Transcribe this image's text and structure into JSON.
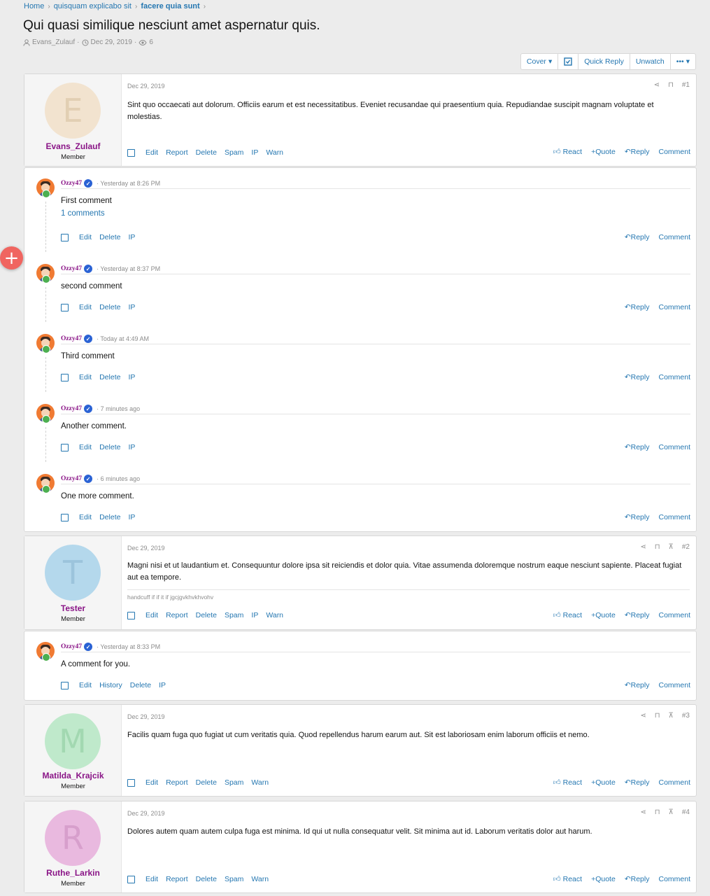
{
  "breadcrumb": {
    "home": "Home",
    "cat": "quisquam explicabo sit",
    "forum": "facere quia sunt"
  },
  "thread": {
    "title": "Qui quasi similique nesciunt amet aspernatur quis.",
    "author": "Evans_Zulauf",
    "date": "Dec 29, 2019",
    "views": "6"
  },
  "toolbar": {
    "cover": "Cover",
    "quick_reply": "Quick Reply",
    "unwatch": "Unwatch",
    "more": "•••"
  },
  "actions": {
    "edit": "Edit",
    "report": "Report",
    "delete": "Delete",
    "spam": "Spam",
    "ip": "IP",
    "warn": "Warn",
    "history": "History",
    "react": "React",
    "quote": "+Quote",
    "reply": "Reply",
    "comment": "Comment"
  },
  "posts": [
    {
      "initial": "E",
      "user": "Evans_Zulauf",
      "title": "Member",
      "date": "Dec 29, 2019",
      "num": "#1",
      "body": "Sint quo occaecati aut dolorum. Officiis earum et est necessitatibus. Eveniet recusandae qui praesentium quia. Repudiandae suscipit magnam voluptate et molestias.",
      "avatar_bg": "#f2e3cf",
      "avatar_fg": "#e2cfb3"
    },
    {
      "initial": "T",
      "user": "Tester",
      "title": "Member",
      "date": "Dec 29, 2019",
      "num": "#2",
      "body": "Magni nisi et ut laudantium et. Consequuntur dolore ipsa sit reiciendis et dolor quia. Vitae assumenda doloremque nostrum eaque nesciunt sapiente. Placeat fugiat aut ea tempore.",
      "signature": "handcuff if if it if jgcjgvkhvkhvohv",
      "avatar_bg": "#b4d8ec",
      "avatar_fg": "#9cc4dc"
    },
    {
      "initial": "M",
      "user": "Matilda_Krajcik",
      "title": "Member",
      "date": "Dec 29, 2019",
      "num": "#3",
      "body": "Facilis quam fuga quo fugiat ut cum veritatis quia. Quod repellendus harum earum aut. Sit est laboriosam enim laborum officiis et nemo.",
      "avatar_bg": "#bfe9cb",
      "avatar_fg": "#a2d8b1"
    },
    {
      "initial": "R",
      "user": "Ruthe_Larkin",
      "title": "Member",
      "date": "Dec 29, 2019",
      "num": "#4",
      "body": "Dolores autem quam autem culpa fuga est minima. Id qui ut nulla consequatur velit. Sit minima aut id. Laborum veritatis dolor aut harum.",
      "avatar_bg": "#e9b9df",
      "avatar_fg": "#d79fcc"
    }
  ],
  "comments": [
    {
      "user": "Ozzy47",
      "time": "Yesterday at 8:26 PM",
      "text": "First comment",
      "sub": "1 comments"
    },
    {
      "user": "Ozzy47",
      "time": "Yesterday at 8:37 PM",
      "text": "second comment"
    },
    {
      "user": "Ozzy47",
      "time": "Today at 4:49 AM",
      "text": "Third comment"
    },
    {
      "user": "Ozzy47",
      "time": "7 minutes ago",
      "text": "Another comment."
    },
    {
      "user": "Ozzy47",
      "time": "6 minutes ago",
      "text": "One more comment."
    },
    {
      "user": "Ozzy47",
      "time": "Yesterday at 8:33 PM",
      "text": "A comment for you."
    }
  ],
  "fab": "+"
}
